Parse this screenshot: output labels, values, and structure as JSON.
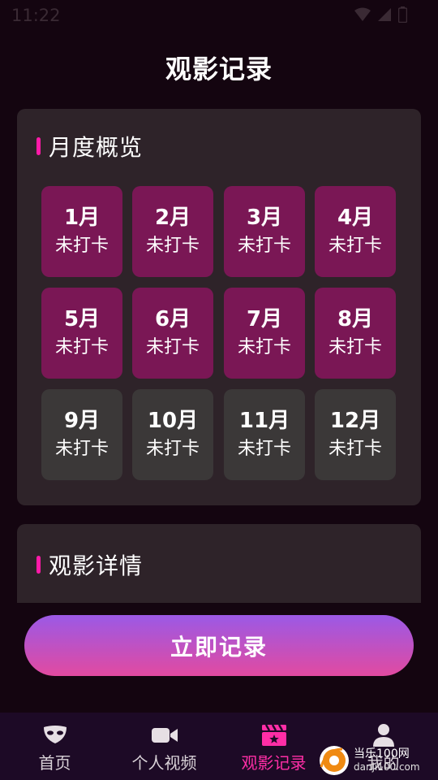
{
  "status_bar": {
    "time": "11:22"
  },
  "header": {
    "title": "观影记录"
  },
  "monthly": {
    "section_title": "月度概览",
    "months": [
      {
        "label": "1月",
        "status": "未打卡",
        "active": true
      },
      {
        "label": "2月",
        "status": "未打卡",
        "active": true
      },
      {
        "label": "3月",
        "status": "未打卡",
        "active": true
      },
      {
        "label": "4月",
        "status": "未打卡",
        "active": true
      },
      {
        "label": "5月",
        "status": "未打卡",
        "active": true
      },
      {
        "label": "6月",
        "status": "未打卡",
        "active": true
      },
      {
        "label": "7月",
        "status": "未打卡",
        "active": true
      },
      {
        "label": "8月",
        "status": "未打卡",
        "active": true
      },
      {
        "label": "9月",
        "status": "未打卡",
        "active": false
      },
      {
        "label": "10月",
        "status": "未打卡",
        "active": false
      },
      {
        "label": "11月",
        "status": "未打卡",
        "active": false
      },
      {
        "label": "12月",
        "status": "未打卡",
        "active": false
      }
    ]
  },
  "details": {
    "section_title": "观影详情"
  },
  "actions": {
    "record_label": "立即记录"
  },
  "nav": {
    "items": [
      {
        "label": "首页",
        "icon": "mask-icon"
      },
      {
        "label": "个人视频",
        "icon": "video-camera-icon"
      },
      {
        "label": "观影记录",
        "icon": "clapperboard-icon"
      },
      {
        "label": "我的",
        "icon": "user-icon"
      }
    ],
    "active_index": 2
  },
  "watermark": {
    "text": "当乐100网",
    "url": "danji100.com"
  },
  "colors": {
    "accent": "#ff2ea6",
    "active_tile": "#7a1755",
    "inactive_tile": "#3b3838",
    "card": "#2e2329",
    "background": "#140510"
  }
}
